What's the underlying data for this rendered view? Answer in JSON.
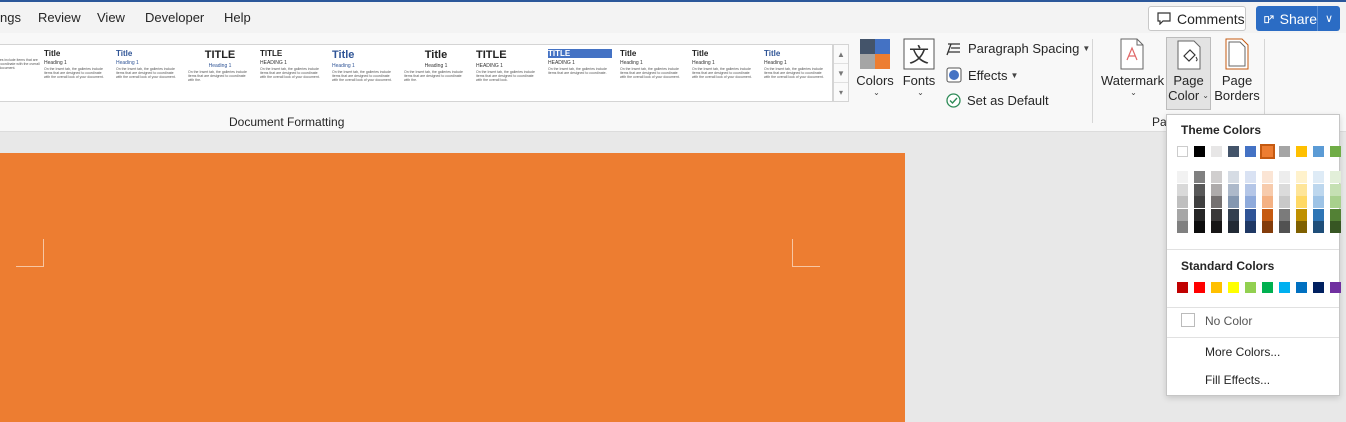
{
  "tabs": [
    "ngs",
    "Review",
    "View",
    "Developer",
    "Help"
  ],
  "actions": {
    "comments": "Comments",
    "share": "Share"
  },
  "gallery": {
    "thumbs": [
      {
        "title": "",
        "heading": "1",
        "text": "ia, the galleries include items that are designed to coordinate with the overall look of your document."
      },
      {
        "title": "Title",
        "heading": "Heading 1",
        "text": "On the Insert tab, the galleries include items that are designed to coordinate with the overall look of your document."
      },
      {
        "title": "Title",
        "heading": "Heading 1",
        "text": "On the Insert tab, the galleries include items that are designed to coordinate with the overall look of your document."
      },
      {
        "title": "TITLE",
        "heading": "Heading 1",
        "text": "On the Insert tab, the galleries include items that are designed to coordinate with the."
      },
      {
        "title": "TITLE",
        "heading": "HEADING 1",
        "text": "On the Insert tab, the galleries include items that are designed to coordinate with the overall look of your document."
      },
      {
        "title": "Title",
        "heading": "Heading 1",
        "text": "On the Insert tab, the galleries include items that are designed to coordinate with the overall look of your document."
      },
      {
        "title": "Title",
        "heading": "Heading 1",
        "text": "On the Insert tab, the galleries include items that are designed to coordinate with the."
      },
      {
        "title": "TITLE",
        "heading": "HEADING 1",
        "text": "On the Insert tab, the galleries include items that are designed to coordinate with the overall look."
      },
      {
        "title": "TITLE",
        "heading": "HEADING 1",
        "text": "On the Insert tab, the galleries include items that are designed to coordinate."
      },
      {
        "title": "Title",
        "heading": "Heading 1",
        "text": "On the Insert tab, the galleries include items that are designed to coordinate with the overall look of your document."
      },
      {
        "title": "Title",
        "heading": "Heading 1",
        "text": "On the Insert tab, the galleries include items that are designed to coordinate with the overall look of your document."
      },
      {
        "title": "Title",
        "heading": "Heading 1",
        "text": "On the Insert tab, the galleries include items that are designed to coordinate with the overall look of your document."
      }
    ],
    "group_label": "Document Formatting"
  },
  "ribbon": {
    "colors": "Colors",
    "fonts": "Fonts",
    "paragraph_spacing": "Paragraph Spacing",
    "effects": "Effects",
    "set_default": "Set as Default",
    "watermark": "Watermark",
    "page_color_1": "Page",
    "page_color_2": "Color",
    "page_borders_1": "Page",
    "page_borders_2": "Borders",
    "page_bg_label": "Page B"
  },
  "page_color": "#ed7d31",
  "dropdown": {
    "theme_header": "Theme Colors",
    "standard_header": "Standard Colors",
    "no_color": "No Color",
    "more_colors": "More Colors...",
    "fill_effects": "Fill Effects...",
    "theme_top": [
      "#ffffff",
      "#000000",
      "#e7e6e6",
      "#44546a",
      "#4472c4",
      "#ed7d31",
      "#a5a5a5",
      "#ffc000",
      "#5b9bd5",
      "#70ad47"
    ],
    "theme_shades": [
      [
        "#f2f2f2",
        "#d9d9d9",
        "#bfbfbf",
        "#a6a6a6",
        "#808080"
      ],
      [
        "#808080",
        "#595959",
        "#404040",
        "#262626",
        "#0d0d0d"
      ],
      [
        "#d0cece",
        "#aeabab",
        "#757171",
        "#3a3838",
        "#171616"
      ],
      [
        "#d6dce4",
        "#adb9ca",
        "#8497b0",
        "#333f4f",
        "#222a35"
      ],
      [
        "#d9e2f3",
        "#b4c6e7",
        "#8eaadb",
        "#2f5496",
        "#1f3864"
      ],
      [
        "#fbe5d5",
        "#f7cbac",
        "#f4b183",
        "#c55a11",
        "#833c0b"
      ],
      [
        "#ededed",
        "#dbdbdb",
        "#c9c9c9",
        "#7b7b7b",
        "#525252"
      ],
      [
        "#fff2cc",
        "#fee599",
        "#ffd965",
        "#bf9000",
        "#7f6000"
      ],
      [
        "#deebf6",
        "#bdd7ee",
        "#9dc3e6",
        "#2e75b5",
        "#1f4e79"
      ],
      [
        "#e2efd9",
        "#c5e0b3",
        "#a8d08d",
        "#538135",
        "#375623"
      ]
    ],
    "standard": [
      "#c00000",
      "#ff0000",
      "#ffc000",
      "#ffff00",
      "#92d050",
      "#00b050",
      "#00b0f0",
      "#0070c0",
      "#002060",
      "#7030a0"
    ],
    "selected": "#ed7d31"
  }
}
